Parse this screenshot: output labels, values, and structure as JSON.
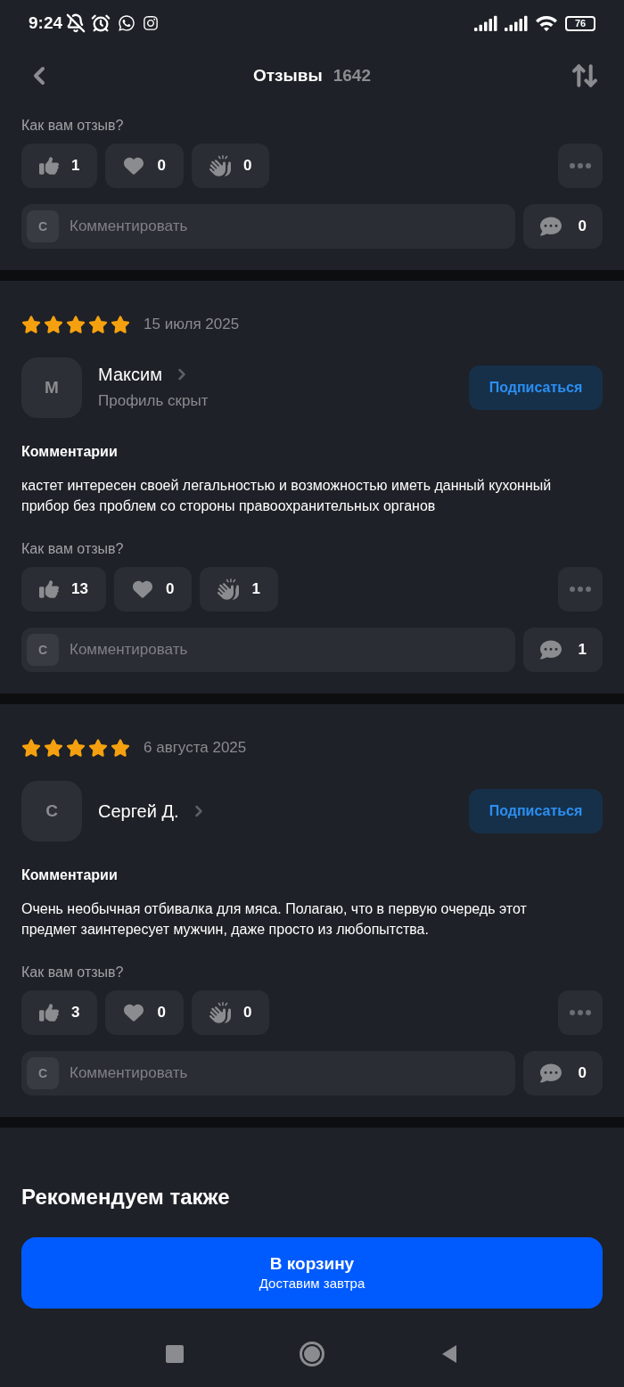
{
  "status_bar": {
    "time": "9:24",
    "battery": "76"
  },
  "header": {
    "title": "Отзывы",
    "count": "1642"
  },
  "reviews": [
    {
      "question": "Как вам отзыв?",
      "reactions": [
        {
          "kind": "like",
          "count": "1"
        },
        {
          "kind": "heart",
          "count": "0"
        },
        {
          "kind": "clap",
          "count": "0"
        }
      ],
      "comment_avatar": "С",
      "comment_placeholder": "Комментировать",
      "comments_count": "0"
    },
    {
      "stars": 5,
      "date": "15 июля 2025",
      "avatar": "М",
      "name": "Максим",
      "subtitle": "Профиль скрыт",
      "subscribe": "Подписаться",
      "comments_heading": "Комментарии",
      "text": "кастет интересен своей легальностью и возможностью иметь данный кухонный прибор без проблем со стороны правоохранительных органов",
      "question": "Как вам отзыв?",
      "reactions": [
        {
          "kind": "like",
          "count": "13"
        },
        {
          "kind": "heart",
          "count": "0"
        },
        {
          "kind": "clap",
          "count": "1"
        }
      ],
      "comment_avatar": "С",
      "comment_placeholder": "Комментировать",
      "comments_count": "1"
    },
    {
      "stars": 5,
      "date": "6 августа 2025",
      "avatar": "С",
      "name": "Сергей Д.",
      "subscribe": "Подписаться",
      "comments_heading": "Комментарии",
      "text": "Очень необычная отбивалка для мяса. Полагаю, что в первую очередь этот предмет заинтересует мужчин, даже просто из любопытства.",
      "question": "Как вам отзыв?",
      "reactions": [
        {
          "kind": "like",
          "count": "3"
        },
        {
          "kind": "heart",
          "count": "0"
        },
        {
          "kind": "clap",
          "count": "0"
        }
      ],
      "comment_avatar": "С",
      "comment_placeholder": "Комментировать",
      "comments_count": "0"
    }
  ],
  "recommend": {
    "title": "Рекомендуем также"
  },
  "cart_button": {
    "label": "В корзину",
    "sublabel": "Доставим завтра"
  }
}
